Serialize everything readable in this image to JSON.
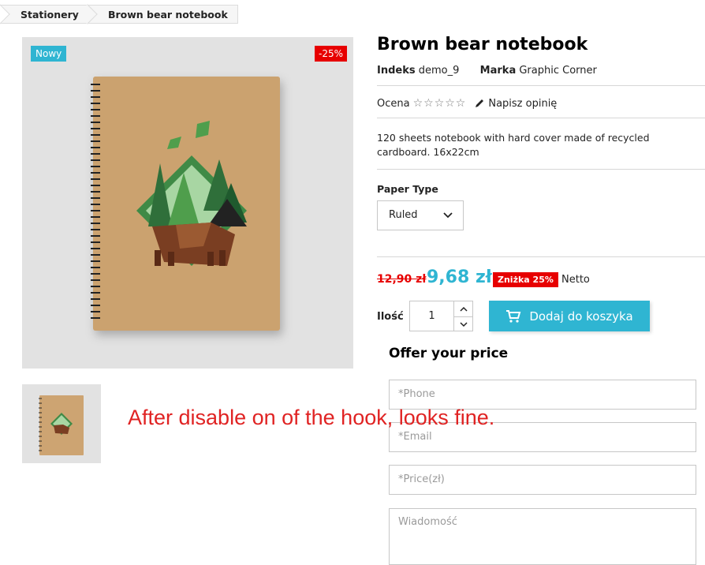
{
  "breadcrumb": {
    "items": [
      "Stationery",
      "Brown bear notebook"
    ]
  },
  "badges": {
    "new": "Nowy",
    "discount": "-25%"
  },
  "product": {
    "title": "Brown bear notebook",
    "index_label": "Indeks",
    "index_value": "demo_9",
    "brand_label": "Marka",
    "brand_value": "Graphic Corner",
    "rating_label": "Ocena",
    "write_review": "Napisz opinię",
    "description": "120 sheets notebook with hard cover made of recycled cardboard. 16x22cm",
    "paper_type_label": "Paper Type",
    "paper_type_selected": "Ruled",
    "old_price": "12,90 zł",
    "new_price": "9,68 zł",
    "discount_tag": "Zniżka 25%",
    "tax_label": "Netto",
    "quantity_label": "Ilość",
    "quantity": "1",
    "add_to_cart": "Dodaj do koszyka",
    "rating_stars": 0
  },
  "offer": {
    "title": "Offer your price",
    "phone_placeholder": "*Phone",
    "email_placeholder": "*Email",
    "price_placeholder": "*Price(zł)",
    "message_placeholder": "Wiadomość"
  },
  "annotation": "After disable on of the hook, looks fine.",
  "colors": {
    "accent": "#2fb5d2",
    "discount": "#e70000",
    "notebook": "#cda472"
  }
}
